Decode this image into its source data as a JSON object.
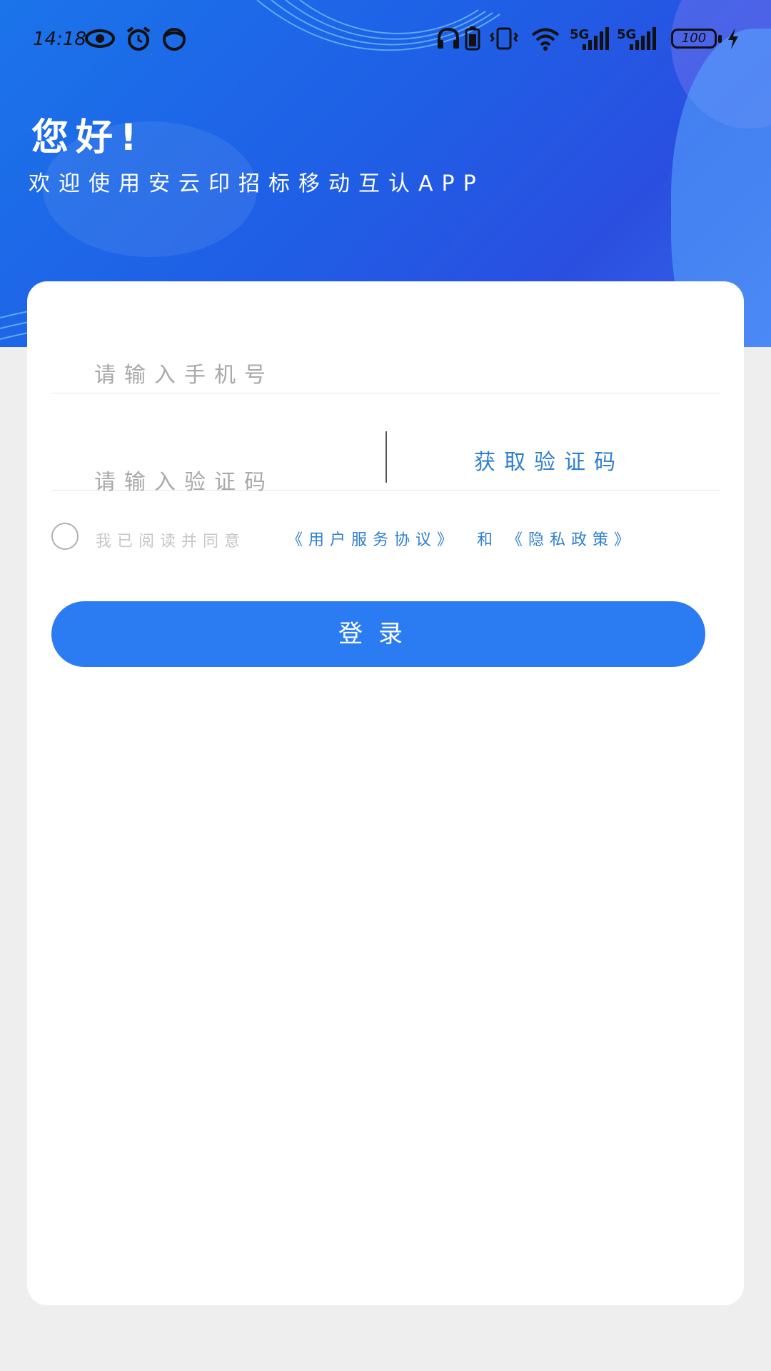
{
  "status_bar": {
    "time": "14:18",
    "icons": [
      "eye-icon",
      "alarm-icon",
      "app-icon",
      "headphones-icon",
      "battery-saver-icon",
      "vibrate-icon",
      "wifi-icon",
      "signal-5g-icon",
      "signal-5g-icon",
      "charging-icon"
    ],
    "signal_label_1": "5G",
    "signal_label_2": "5G",
    "battery": "100"
  },
  "header": {
    "title": "您好!",
    "subtitle": "欢迎使用安云印招标移动互认APP"
  },
  "form": {
    "phone_placeholder": "请输入手机号",
    "code_placeholder": "请输入验证码",
    "get_code_label": "获取验证码"
  },
  "agreement": {
    "prefix": "我已阅读并同意",
    "user_agreement": "《用户服务协议》",
    "and": "和",
    "privacy_policy": "《隐私政策》"
  },
  "login": {
    "label": "登录"
  },
  "colors": {
    "brand_blue": "#2b7cf3",
    "link_blue": "#2f7fd0"
  }
}
